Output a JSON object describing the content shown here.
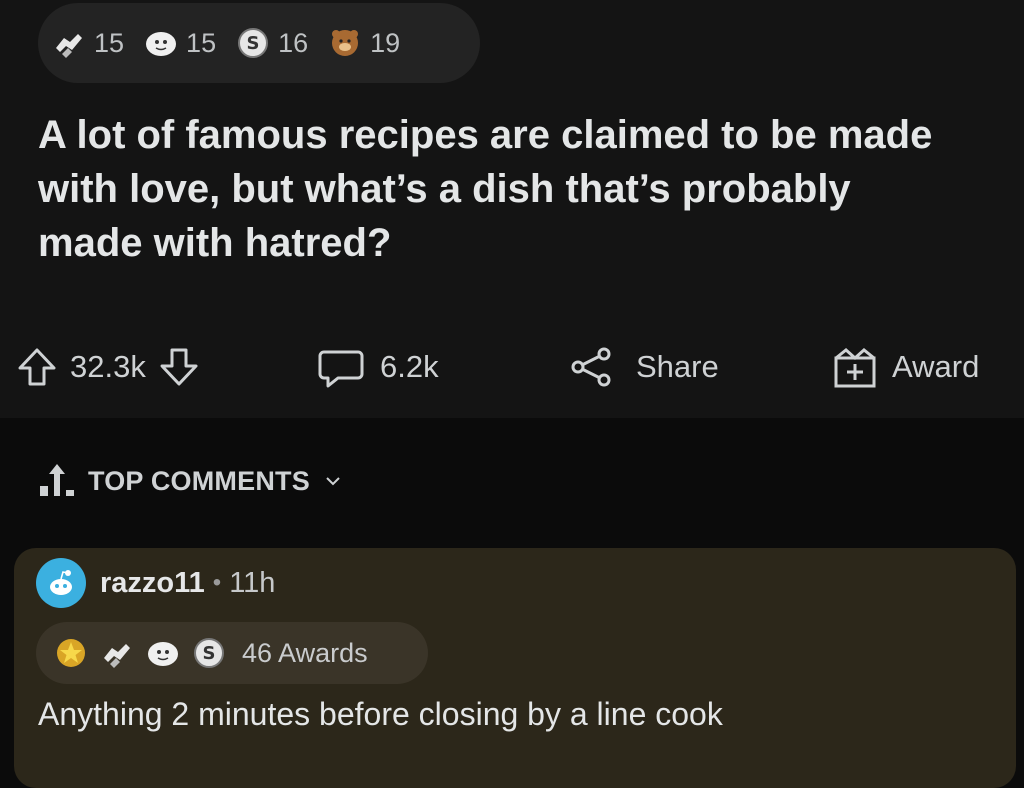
{
  "post": {
    "awards": [
      {
        "icon": "handshake-award-icon",
        "count": "15"
      },
      {
        "icon": "face-award-icon",
        "count": "15"
      },
      {
        "icon": "coin-award-icon",
        "count": "16"
      },
      {
        "icon": "bear-award-icon",
        "count": "19"
      }
    ],
    "title": "A lot of famous recipes are claimed to be made with love, but what’s a dish that’s probably made with hatred?",
    "votes": "32.3k",
    "comments": "6.2k",
    "share_label": "Share",
    "award_label": "Award"
  },
  "top_comments": {
    "label": "TOP COMMENTS"
  },
  "comment": {
    "username": "razzo11",
    "separator": "•",
    "time": "11h",
    "awards_label": "46 Awards",
    "award_icons": [
      "star-award-icon",
      "handshake-award-icon",
      "face-award-icon",
      "coin-award-icon"
    ],
    "body": "Anything 2 minutes before closing by a line cook"
  },
  "colors": {
    "background": "#0b0b0b",
    "post_background": "#141414",
    "comment_background": "#2c271a",
    "avatar": "#3bb0e0"
  }
}
